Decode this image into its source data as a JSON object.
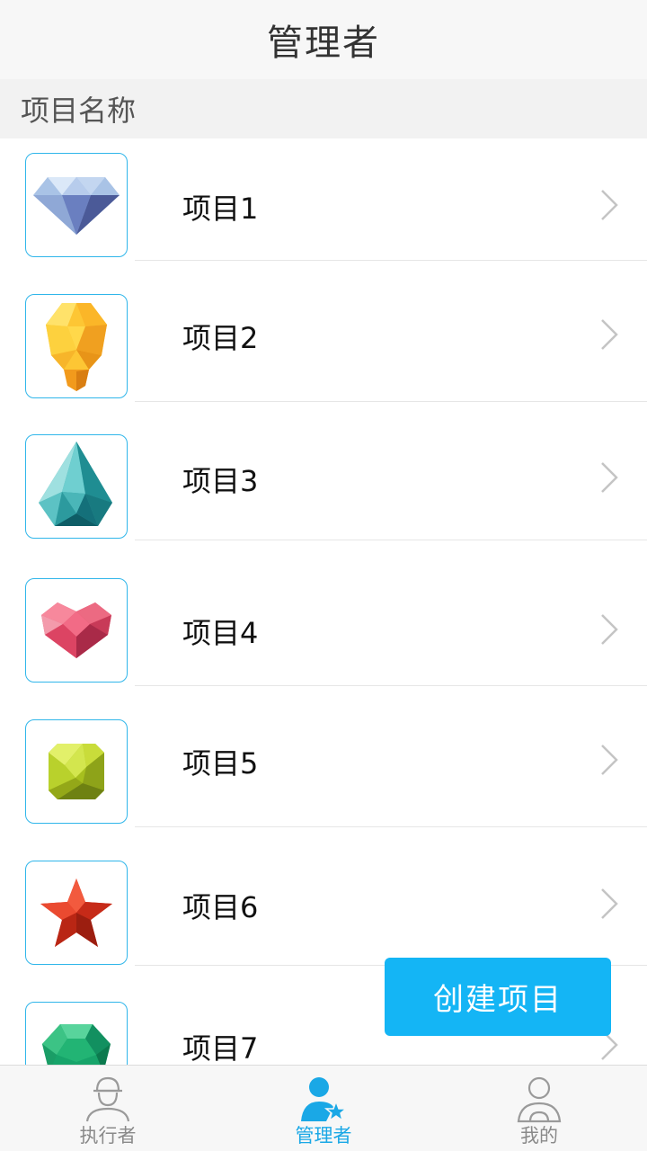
{
  "header": {
    "title": "管理者"
  },
  "section": {
    "title": "项目名称"
  },
  "items": [
    {
      "label": "项目1",
      "icon": "diamond-icon"
    },
    {
      "label": "项目2",
      "icon": "lightbulb-icon"
    },
    {
      "label": "项目3",
      "icon": "teardrop-gem-icon"
    },
    {
      "label": "项目4",
      "icon": "heart-icon"
    },
    {
      "label": "项目5",
      "icon": "cube-gem-icon"
    },
    {
      "label": "项目6",
      "icon": "star-icon"
    },
    {
      "label": "项目7",
      "icon": "emerald-icon"
    }
  ],
  "fab": {
    "label": "创建项目"
  },
  "tabbar": {
    "tabs": [
      {
        "label": "执行者",
        "icon": "worker-icon"
      },
      {
        "label": "管理者",
        "icon": "manager-icon"
      },
      {
        "label": "我的",
        "icon": "profile-icon"
      }
    ],
    "active": "管理者"
  },
  "colors": {
    "accent": "#14b5f5",
    "active_tab": "#1aa8e6",
    "thumb_border": "#30b6ea"
  }
}
